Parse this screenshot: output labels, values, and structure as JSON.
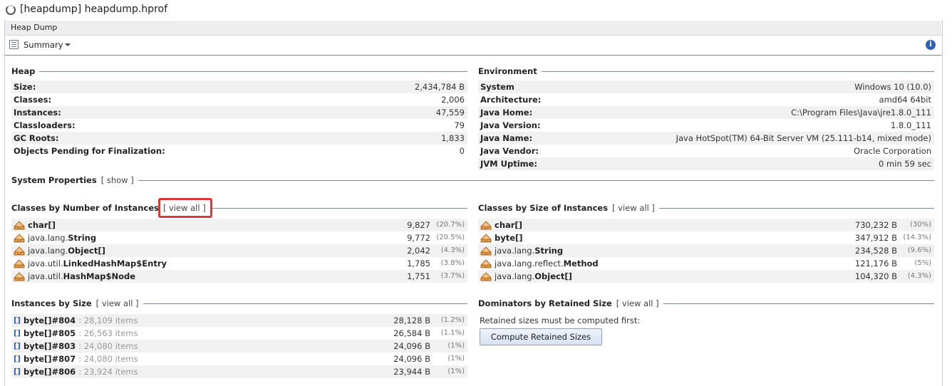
{
  "window": {
    "title": "[heapdump] heapdump.hprof"
  },
  "tab": {
    "label": "Heap Dump"
  },
  "toolbar": {
    "view_label": "Summary"
  },
  "heap": {
    "title": "Heap",
    "rows": [
      {
        "label": "Size:",
        "value": "2,434,784 B"
      },
      {
        "label": "Classes:",
        "value": "2,006"
      },
      {
        "label": "Instances:",
        "value": "47,559"
      },
      {
        "label": "Classloaders:",
        "value": "79"
      },
      {
        "label": "GC Roots:",
        "value": "1,833"
      },
      {
        "label": "Objects Pending for Finalization:",
        "value": "0"
      }
    ]
  },
  "environment": {
    "title": "Environment",
    "rows": [
      {
        "label": "System",
        "value": "Windows 10 (10.0)"
      },
      {
        "label": "Architecture:",
        "value": "amd64 64bit"
      },
      {
        "label": "Java Home:",
        "value": "C:\\Program Files\\Java\\jre1.8.0_111"
      },
      {
        "label": "Java Version:",
        "value": "1.8.0_111"
      },
      {
        "label": "Java Name:",
        "value": "Java HotSpot(TM) 64-Bit Server VM (25.111-b14, mixed mode)"
      },
      {
        "label": "Java Vendor:",
        "value": "Oracle Corporation"
      },
      {
        "label": "JVM Uptime:",
        "value": "0 min 59 sec"
      }
    ]
  },
  "system_properties": {
    "title": "System Properties",
    "link": "[ show ]"
  },
  "classes_by_number": {
    "title": "Classes by Number of Instances",
    "link": "[ view all ]",
    "rows": [
      {
        "pkg": "",
        "cls": "char[]",
        "value": "9,827",
        "pct": "(20.7%)"
      },
      {
        "pkg": "java.lang.",
        "cls": "String",
        "value": "9,772",
        "pct": "(20.5%)"
      },
      {
        "pkg": "java.lang.",
        "cls": "Object[]",
        "value": "2,042",
        "pct": "(4.3%)"
      },
      {
        "pkg": "java.util.",
        "cls": "LinkedHashMap$Entry",
        "value": "1,785",
        "pct": "(3.8%)"
      },
      {
        "pkg": "java.util.",
        "cls": "HashMap$Node",
        "value": "1,751",
        "pct": "(3.7%)"
      }
    ]
  },
  "classes_by_size": {
    "title": "Classes by Size of Instances",
    "link": "[ view all ]",
    "rows": [
      {
        "pkg": "",
        "cls": "char[]",
        "value": "730,232 B",
        "pct": "(30%)"
      },
      {
        "pkg": "",
        "cls": "byte[]",
        "value": "347,912 B",
        "pct": "(14.3%)"
      },
      {
        "pkg": "java.lang.",
        "cls": "String",
        "value": "234,528 B",
        "pct": "(9.6%)"
      },
      {
        "pkg": "java.lang.reflect.",
        "cls": "Method",
        "value": "121,176 B",
        "pct": "(5%)"
      },
      {
        "pkg": "java.lang.",
        "cls": "Object[]",
        "value": "104,320 B",
        "pct": "(4.3%)"
      }
    ]
  },
  "instances_by_size": {
    "title": "Instances by Size",
    "link": "[ view all ]",
    "rows": [
      {
        "name": "byte[]#804",
        "items": ": 28,109 items",
        "value": "28,128 B",
        "pct": "(1.2%)"
      },
      {
        "name": "byte[]#805",
        "items": ": 26,563 items",
        "value": "26,584 B",
        "pct": "(1.1%)"
      },
      {
        "name": "byte[]#803",
        "items": ": 24,080 items",
        "value": "24,096 B",
        "pct": "(1%)"
      },
      {
        "name": "byte[]#807",
        "items": ": 24,080 items",
        "value": "24,096 B",
        "pct": "(1%)"
      },
      {
        "name": "byte[]#806",
        "items": ": 23,924 items",
        "value": "23,944 B",
        "pct": "(1%)"
      }
    ]
  },
  "dominators": {
    "title": "Dominators by Retained Size",
    "link": "[ view all ]",
    "message": "Retained sizes must be computed first:",
    "button": "Compute Retained Sizes"
  }
}
